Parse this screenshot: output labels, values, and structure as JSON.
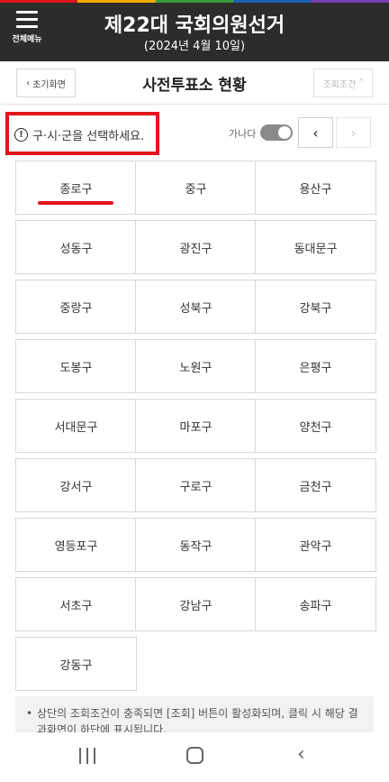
{
  "header": {
    "menu_label": "전체메뉴",
    "title": "제22대 국회의원선거",
    "subtitle": "(2024년 4월 10일)",
    "accent_colors": [
      "#e3141c",
      "#f2a900",
      "#3a9b3a",
      "#1a5fb4",
      "#7a3fb0"
    ]
  },
  "page": {
    "home_button": "초기화면",
    "title": "사전투표소 현황",
    "condition_button": "조회조건"
  },
  "toolbar": {
    "hint": "구·시·군을 선택하세요.",
    "sort_label": "가나다",
    "sort_toggle_on": true,
    "prev_glyph": "‹",
    "next_glyph": "›"
  },
  "districts": [
    "종로구",
    "중구",
    "용산구",
    "성동구",
    "광진구",
    "동대문구",
    "중랑구",
    "성북구",
    "강북구",
    "도봉구",
    "노원구",
    "은평구",
    "서대문구",
    "마포구",
    "양천구",
    "강서구",
    "구로구",
    "금천구",
    "영등포구",
    "동작구",
    "관악구",
    "서초구",
    "강남구",
    "송파구",
    "강동구"
  ],
  "notice": {
    "bullet": "•",
    "text": "상단의 조회조건이 충족되면 [조회] 버튼이 활성화되며, 클릭 시 해당 결과화면이 하단에 표시됩니다."
  },
  "colors": {
    "highlight_red": "#e3141c",
    "topbar": "#2c2c2c"
  }
}
